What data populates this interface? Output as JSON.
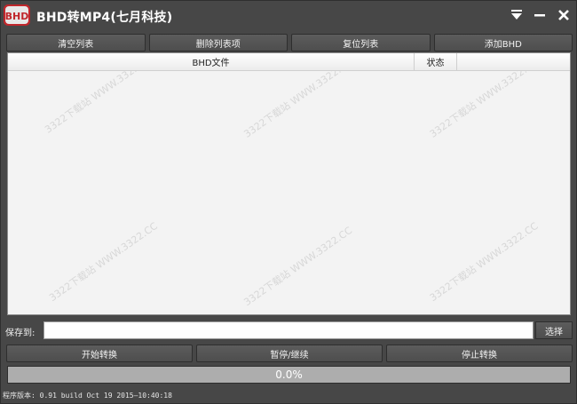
{
  "app": {
    "logo_text": "BHD",
    "title": "BHD转MP4(七月科技)"
  },
  "titlebar": {
    "menu_icon": "menu-down-icon",
    "minimize_icon": "minimize-icon",
    "close_icon": "close-icon"
  },
  "toolbar": {
    "clear_label": "清空列表",
    "delete_label": "删除列表项",
    "reset_label": "复位列表",
    "add_label": "添加BHD"
  },
  "table": {
    "columns": [
      "BHD文件",
      "状态",
      ""
    ],
    "rows": []
  },
  "watermark": {
    "text": "3322下载站 WWW.3322.CC"
  },
  "save": {
    "label": "保存到:",
    "value": "",
    "choose_label": "选择"
  },
  "actions": {
    "start_label": "开始转换",
    "pause_label": "暂停/继续",
    "stop_label": "停止转换"
  },
  "progress": {
    "value": 0,
    "text": "0.0%"
  },
  "status": {
    "version_text": "程序版本: 0.91  build Oct 19 2015—10:40:18"
  },
  "colors": {
    "window_bg": "#474747",
    "list_bg": "#f3f3f3",
    "progress_bg": "#adadad",
    "logo_red": "#c0262b"
  }
}
